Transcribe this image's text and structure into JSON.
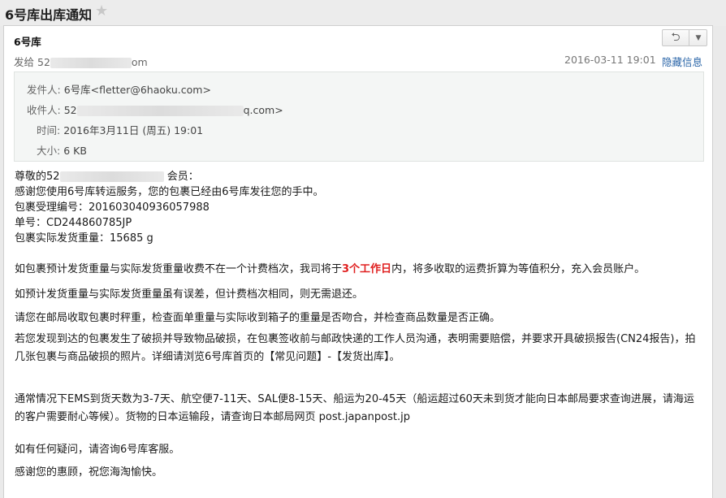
{
  "header": {
    "subject": "6号库出库通知",
    "star_icon": "star-icon"
  },
  "toolbar": {
    "reply_icon": "reply-icon",
    "more_icon": "chevron-down-icon"
  },
  "meta": {
    "sender_name": "6号库",
    "send_to_label": "发给",
    "send_to_prefix": "52",
    "send_to_suffix": "om",
    "date": "2016-03-11 19:01",
    "hide_info": "隐藏信息"
  },
  "details": {
    "from_label": "发件人:",
    "from_value": "6号库<fletter@6haoku.com>",
    "to_label": "收件人:",
    "to_prefix": "52",
    "to_suffix": "q.com>",
    "time_label": "时间:",
    "time_value": "2016年3月11日 (周五) 19:01",
    "size_label": "大小:",
    "size_value": "6 KB"
  },
  "body": {
    "greeting_prefix": "尊敬的",
    "greeting_prefix_blur": "52",
    "greeting_suffix": "会员：",
    "thanks": "感谢您使用6号库转运服务，您的包裹已经由6号库发往您的手中。",
    "tracking_label": "包裹受理编号：",
    "tracking_value": "201603040936057988",
    "order_label": "单号：",
    "order_value": "CD244860785JP",
    "weight_label": "包裹实际发货重量：",
    "weight_value": "15685 g",
    "para1_a": "如包裹预计发货重量与实际发货重量收费不在一个计费档次，我司将于",
    "para1_highlight": "3个工作日",
    "para1_b": "内，将多收取的运费折算为等值积分，充入会员账户。",
    "para2": "如预计发货重量与实际发货重量虽有误差，但计费档次相同，则无需退还。",
    "para3": "请您在邮局收取包裹时秤重，检查面单重量与实际收到箱子的重量是否吻合，并检查商品数量是否正确。",
    "para4": "若您发现到达的包裹发生了破损并导致物品破损，在包裹签收前与邮政快递的工作人员沟通，表明需要赔偿，并要求开具破损报告(CN24报告)，拍几张包裹与商品破损的照片。详细请浏览6号库首页的【常见问题】-【发货出库】。",
    "para5": "通常情况下EMS到货天数为3-7天、航空便7-11天、SAL便8-15天、船运为20-45天（船运超过60天未到货才能向日本邮局要求查询进展，请海运的客户需要耐心等候）。货物的日本运输段，请查询日本邮局网页 post.japanpost.jp",
    "para6": "如有任何疑问，请咨询6号库客服。",
    "para7": "感谢您的惠顾，祝您海淘愉快。"
  }
}
